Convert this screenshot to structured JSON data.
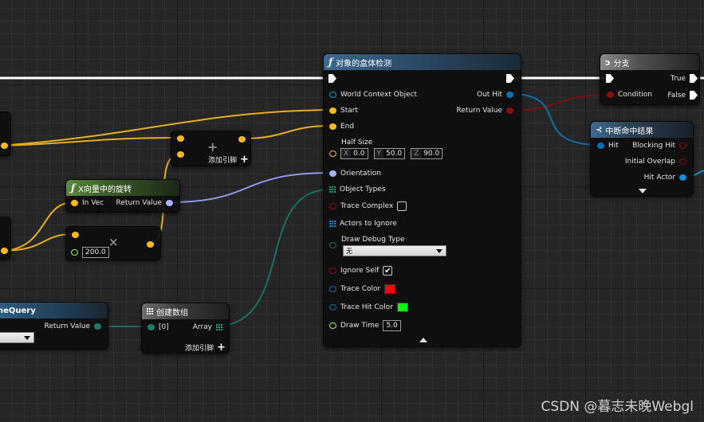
{
  "colors": {
    "exec": "#ffffff",
    "vector": "#f5bb1e",
    "rotator": "#9fa8ff",
    "object": "#0095d6",
    "struct": "#00689f",
    "bool": "#8c0f0f",
    "float": "#9cf244",
    "objecttype": "#1f6a5e"
  },
  "box_trace": {
    "title": "对象的盒体检测",
    "icon": "function-icon",
    "inputs": {
      "world_context": "World Context Object",
      "start": "Start",
      "end": "End",
      "half_size": "Half Size",
      "half_x_label": "X",
      "half_x": "0.0",
      "half_y_label": "Y",
      "half_y": "50.0",
      "half_z_label": "Z",
      "half_z": "90.0",
      "orientation": "Orientation",
      "object_types": "Object Types",
      "trace_complex": "Trace Complex",
      "actors_to_ignore": "Actors to Ignore",
      "draw_debug_type": "Draw Debug Type",
      "draw_debug_value": "无",
      "ignore_self": "Ignore Self",
      "trace_color": "Trace Color",
      "trace_color_value": "#ff0000",
      "trace_hit_color": "Trace Hit Color",
      "trace_hit_color_value": "#00ff00",
      "draw_time": "Draw Time",
      "draw_time_value": "5.0"
    },
    "outputs": {
      "out_hit": "Out Hit",
      "return_value": "Return Value"
    }
  },
  "branch": {
    "title": "分支",
    "condition": "Condition",
    "true_label": "True",
    "false_label": "False"
  },
  "break_hit": {
    "title": "中断命中结果",
    "hit": "Hit",
    "blocking_hit": "Blocking Hit",
    "initial_overlap": "Initial Overlap",
    "hit_actor": "Hit Actor"
  },
  "add_node": {
    "add_pin": "添加引脚"
  },
  "x_vector": {
    "title": "X向量中的旋转",
    "in_vec": "In Vec",
    "return_value": "Return Value"
  },
  "multiply": {
    "value": "200.0"
  },
  "make_array": {
    "title": "创建数组",
    "index0": "[0]",
    "array": "Array",
    "add_pin": "添加引脚"
  },
  "query_node": {
    "title": "neQuery",
    "return_value": "Return Value"
  },
  "watermark": "CSDN @暮志未晚Webgl"
}
